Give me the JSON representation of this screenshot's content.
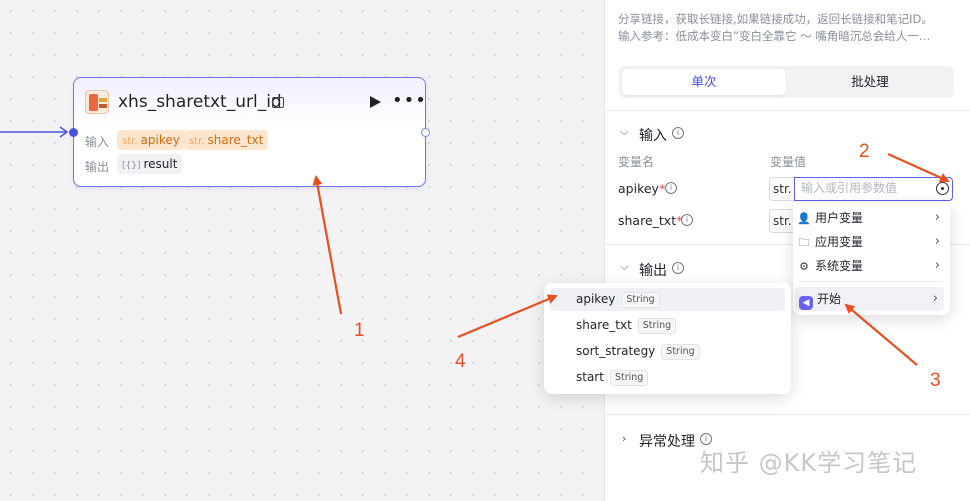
{
  "node": {
    "title": "xhs_sharetxt_url_id",
    "input_label": "输入",
    "output_label": "输出",
    "inputs": [
      {
        "type": "str.",
        "name": "apikey"
      },
      {
        "type": "str.",
        "name": "share_txt"
      }
    ],
    "output": {
      "type": "[{}]",
      "name": "result"
    }
  },
  "panel": {
    "desc_line1": "分享链接，获取长链接,如果链接成功，返回长链接和笔记ID。",
    "desc_line2": "输入参考：低成本变白”变白全靠它 〜 嘴角暗沉总会给人一…",
    "tabs": {
      "single": "单次",
      "batch": "批处理"
    },
    "input_section": "输入",
    "col_var_name": "变量名",
    "col_var_value": "变量值",
    "vars": [
      {
        "name": "apikey",
        "required": "*",
        "type": "str."
      },
      {
        "name": "share_txt",
        "required": "*",
        "type": "str."
      }
    ],
    "value_placeholder": "输入或引用参数值",
    "output_section": "输出",
    "error_section": "异常处理"
  },
  "ref_menu": {
    "items": [
      {
        "icon": "user-icon",
        "label": "用户变量"
      },
      {
        "icon": "folder-icon",
        "label": "应用变量"
      },
      {
        "icon": "gear-icon",
        "label": "系统变量"
      }
    ],
    "start_label": "开始"
  },
  "sub_menu": {
    "items": [
      {
        "name": "apikey",
        "type": "String"
      },
      {
        "name": "share_txt",
        "type": "String"
      },
      {
        "name": "sort_strategy",
        "type": "String"
      },
      {
        "name": "start",
        "type": "String"
      }
    ]
  },
  "annotations": {
    "n1": "1",
    "n2": "2",
    "n3": "3",
    "n4": "4"
  },
  "watermark": "知乎 @KK学习笔记",
  "colors": {
    "accent": "#5a63e6",
    "annotation": "#e8501f",
    "tag_orange": "#d76a0f"
  }
}
